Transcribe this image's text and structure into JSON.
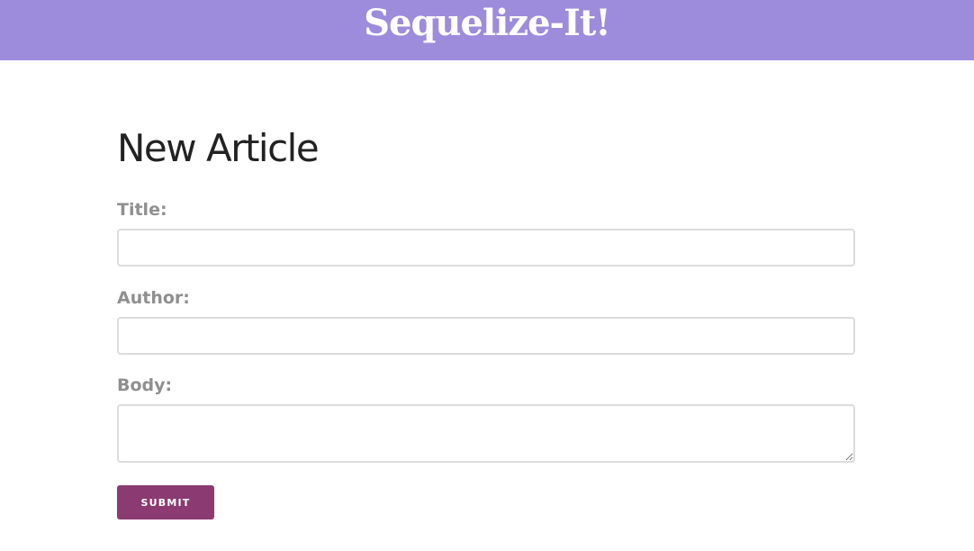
{
  "header": {
    "site_title": "Sequelize-It!"
  },
  "main": {
    "page_title": "New Article",
    "form": {
      "title_label": "Title:",
      "title_value": "",
      "author_label": "Author:",
      "author_value": "",
      "body_label": "Body:",
      "body_value": "",
      "submit_label": "SUBMIT"
    }
  },
  "colors": {
    "header_bg": "#9d8bdc",
    "submit_bg": "#8b3a72",
    "label_color": "#8f8f8f",
    "input_border": "#dcdcdc"
  }
}
